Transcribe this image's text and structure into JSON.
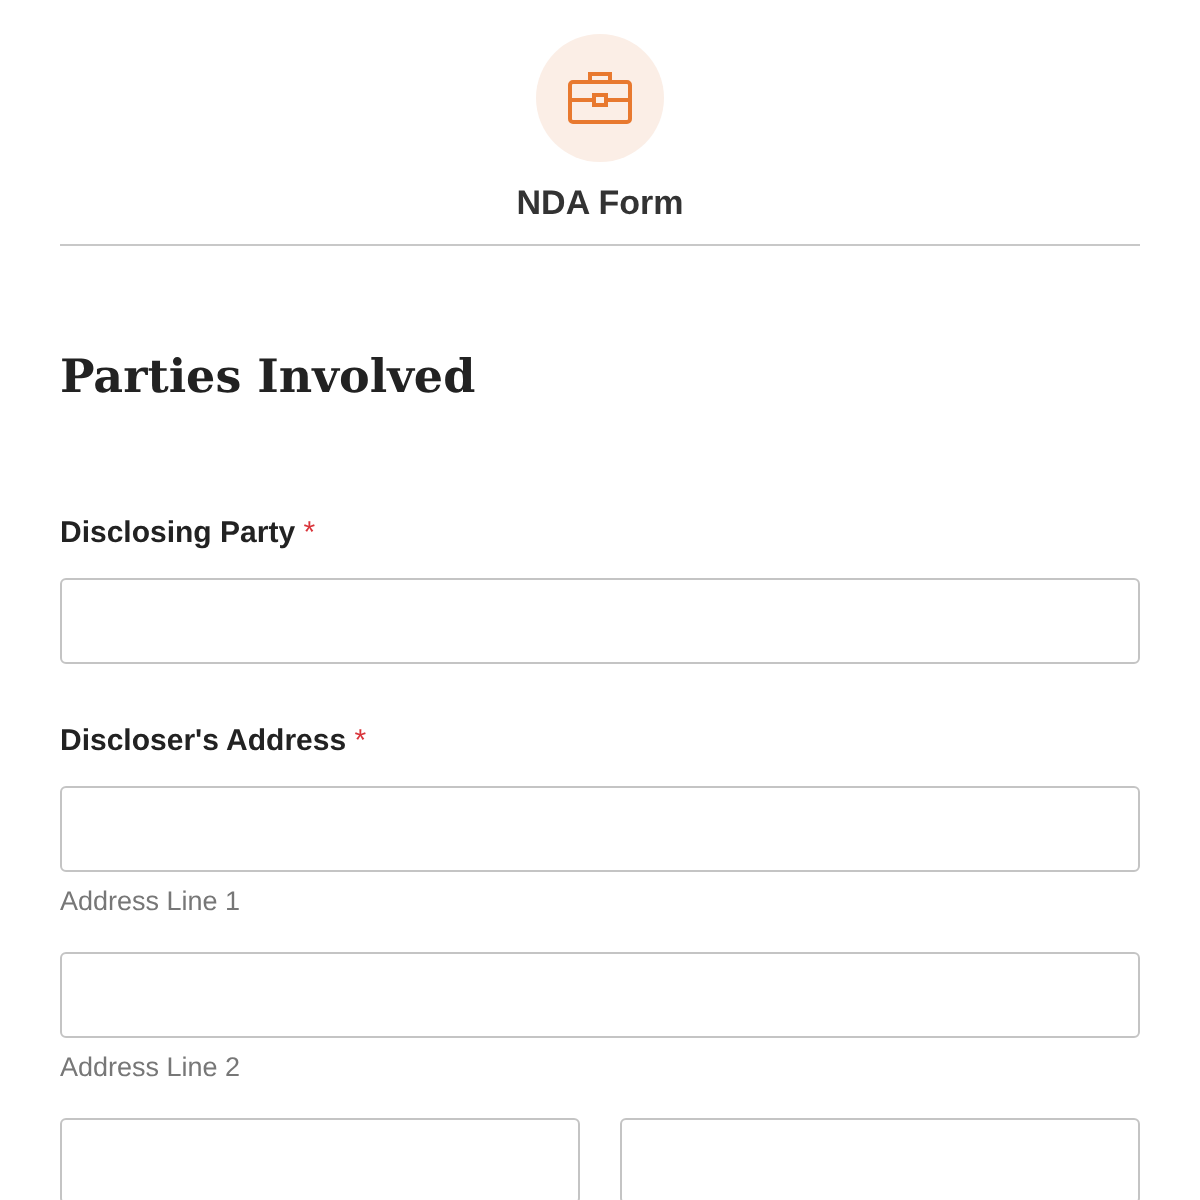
{
  "header": {
    "title": "NDA Form"
  },
  "section_title": "Parties Involved",
  "fields": [
    {
      "kind": "single",
      "label": "Disclosing Party",
      "required_mark": "*"
    },
    {
      "kind": "address",
      "label": "Discloser's Address",
      "required_mark": "*",
      "sublabels": [
        "Address Line 1",
        "Address Line 2"
      ]
    }
  ]
}
